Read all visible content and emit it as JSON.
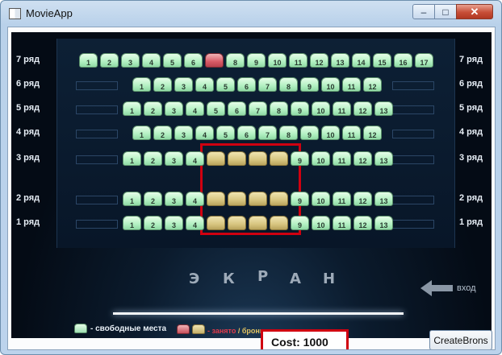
{
  "window": {
    "title": "MovieApp",
    "min_icon": "minimize-icon",
    "max_icon": "maximize-icon",
    "close_icon": "close-icon"
  },
  "rows": [
    {
      "label": "7 ряд",
      "seats": [
        "1",
        "2",
        "3",
        "4",
        "5",
        "6",
        "",
        "8",
        "9",
        "10",
        "11",
        "12",
        "13",
        "14",
        "15",
        "16",
        "17"
      ],
      "taken": [
        7
      ],
      "selected": []
    },
    {
      "label": "6 ряд",
      "seats": [
        "1",
        "2",
        "3",
        "4",
        "5",
        "6",
        "7",
        "8",
        "9",
        "10",
        "11",
        "12"
      ],
      "taken": [],
      "selected": []
    },
    {
      "label": "5 ряд",
      "seats": [
        "1",
        "2",
        "3",
        "4",
        "5",
        "6",
        "7",
        "8",
        "9",
        "10",
        "11",
        "12",
        "13"
      ],
      "taken": [],
      "selected": []
    },
    {
      "label": "4 ряд",
      "seats": [
        "1",
        "2",
        "3",
        "4",
        "5",
        "6",
        "7",
        "8",
        "9",
        "10",
        "11",
        "12"
      ],
      "taken": [],
      "selected": []
    },
    {
      "label": "3 ряд",
      "seats": [
        "1",
        "2",
        "3",
        "4",
        "",
        "",
        "",
        "",
        "9",
        "10",
        "11",
        "12",
        "13"
      ],
      "taken": [],
      "selected": [
        5,
        6,
        7,
        8
      ]
    },
    {
      "label": "2 ряд",
      "seats": [
        "1",
        "2",
        "3",
        "4",
        "",
        "",
        "",
        "",
        "9",
        "10",
        "11",
        "12",
        "13"
      ],
      "taken": [],
      "selected": [
        5,
        6,
        7,
        8
      ]
    },
    {
      "label": "1 ряд",
      "seats": [
        "1",
        "2",
        "3",
        "4",
        "",
        "",
        "",
        "",
        "9",
        "10",
        "11",
        "12",
        "13"
      ],
      "taken": [],
      "selected": [
        5,
        6,
        7,
        8
      ]
    }
  ],
  "screen_letters": [
    "Э",
    "К",
    "Р",
    "А",
    "Н"
  ],
  "exit_label": "вход",
  "legend": {
    "free_label": "- свободные места",
    "taken_label": "- занято",
    "book_label": " / бронь"
  },
  "cost_text": "Cost: 1000",
  "create_button": "CreateBrons",
  "colors": {
    "free_seat": "#b2f0c2",
    "taken_seat": "#d85a66",
    "selected_seat": "#d7c580",
    "highlight": "#d00010"
  }
}
